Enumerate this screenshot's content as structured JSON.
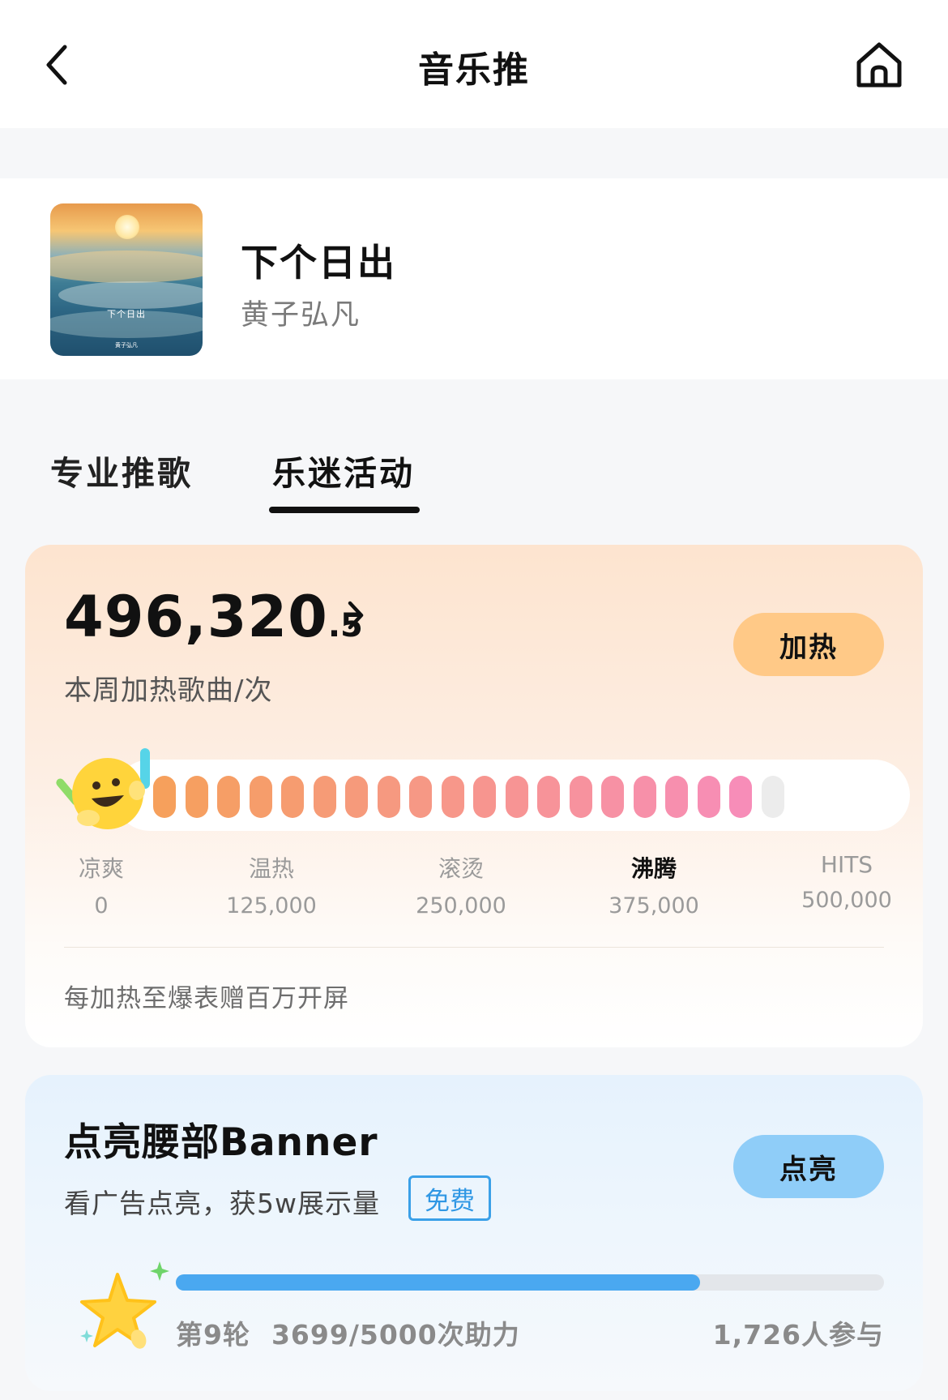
{
  "nav": {
    "title": "音乐推",
    "back_icon": "chevron-left-icon",
    "home_icon": "home-icon"
  },
  "song": {
    "title": "下个日出",
    "artist": "黄子弘凡",
    "cover_title": "下个日出",
    "cover_artist": "黄子弘凡"
  },
  "tabs": [
    {
      "label": "专业推歌",
      "active": false
    },
    {
      "label": "乐迷活动",
      "active": true
    }
  ],
  "heat": {
    "value_int": "496,320",
    "value_dec": ".5",
    "label": "本周加热歌曲/次",
    "button": "加热",
    "total_segments": 20,
    "filled_segments": 19,
    "segment_colors": [
      "#f6a05c",
      "#f78db8"
    ],
    "empty_segment_color": "#ececec",
    "levels": [
      {
        "name": "凉爽",
        "value": "0",
        "active": false
      },
      {
        "name": "温热",
        "value": "125,000",
        "active": false
      },
      {
        "name": "滚烫",
        "value": "250,000",
        "active": false
      },
      {
        "name": "沸腾",
        "value": "375,000",
        "active": true
      },
      {
        "name": "HITS",
        "value": "500,000",
        "active": false
      }
    ],
    "tip": "每加热至爆表赠百万开屏"
  },
  "banner": {
    "title": "点亮腰部Banner",
    "subtitle": "看广告点亮，获5w展示量",
    "badge": "免费",
    "button": "点亮",
    "round": "第9轮",
    "assist": "3699/5000次助力",
    "progress": 0.7398,
    "participants": "1,726人参与",
    "accent": "#4aa8f0"
  }
}
